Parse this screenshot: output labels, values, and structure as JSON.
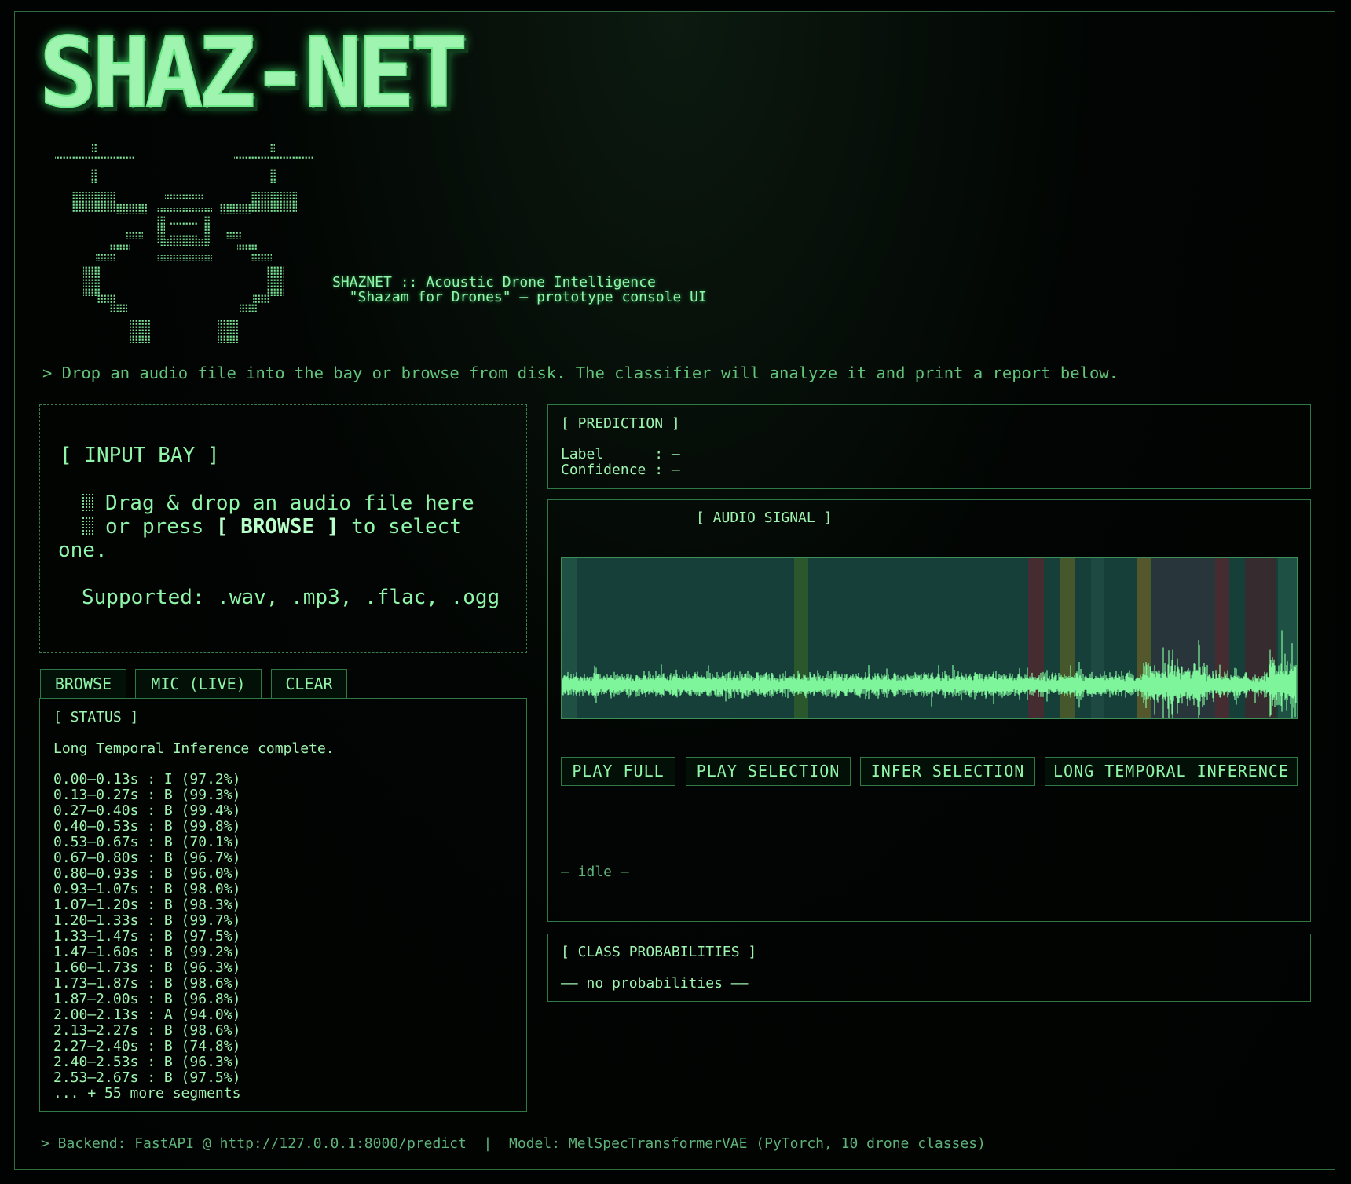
{
  "app": {
    "logo_text": "SHAZ-NET",
    "subtitle_line1": "SHAZNET :: Acoustic Drone Intelligence",
    "subtitle_line2": "  \"Shazam for Drones\" — prototype console UI",
    "hint": "> Drop an audio file into the bay or browse from disk. The classifier will analyze it and print a report below."
  },
  "input_bay": {
    "title": "[ INPUT BAY ]",
    "line1": "Drag & drop an audio file here",
    "line2_pre": "or press ",
    "line2_bold": "[ BROWSE ]",
    "line2_post": " to select",
    "line3": "one.",
    "supported": "Supported: .wav, .mp3, .flac, .ogg"
  },
  "tabs": {
    "browse": "BROWSE",
    "mic": "MIC (LIVE)",
    "clear": "CLEAR"
  },
  "status": {
    "title": "[ STATUS ]",
    "message": "Long Temporal Inference complete.",
    "segments": [
      "0.00–0.13s : I (97.2%)",
      "0.13–0.27s : B (99.3%)",
      "0.27–0.40s : B (99.4%)",
      "0.40–0.53s : B (99.8%)",
      "0.53–0.67s : B (70.1%)",
      "0.67–0.80s : B (96.7%)",
      "0.80–0.93s : B (96.0%)",
      "0.93–1.07s : B (98.0%)",
      "1.07–1.20s : B (98.3%)",
      "1.20–1.33s : B (99.7%)",
      "1.33–1.47s : B (97.5%)",
      "1.47–1.60s : B (99.2%)",
      "1.60–1.73s : B (96.3%)",
      "1.73–1.87s : B (98.6%)",
      "1.87–2.00s : B (96.8%)",
      "2.00–2.13s : A (94.0%)",
      "2.13–2.27s : B (98.6%)",
      "2.27–2.40s : B (74.8%)",
      "2.40–2.53s : B (96.3%)",
      "2.53–2.67s : B (97.5%)",
      "... + 55 more segments"
    ]
  },
  "prediction": {
    "title": "[ PREDICTION ]",
    "label_line": "Label      : –",
    "confidence_line": "Confidence : –"
  },
  "audio_signal": {
    "title": "[ AUDIO SIGNAL ]",
    "controls": {
      "play_full": "PLAY FULL",
      "play_selection": "PLAY SELECTION",
      "infer_selection": "INFER SELECTION",
      "long_temporal": "LONG TEMPORAL INFERENCE"
    },
    "state": "– idle –"
  },
  "class_probabilities": {
    "title": "[ CLASS PROBABILITIES ]",
    "empty": "–– no probabilities ––"
  },
  "footer": {
    "text": "> Backend: FastAPI @ http://127.0.0.1:8000/predict  |  Model: MelSpecTransformerVAE (PyTorch, 10 drone classes)"
  },
  "colors": {
    "background": "#010302",
    "accent": "#7ee89a",
    "border": "#2f7a44",
    "waveform_bg": "#173f3a"
  }
}
